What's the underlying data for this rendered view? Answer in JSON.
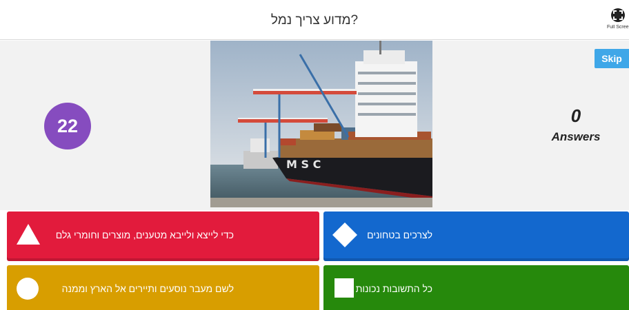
{
  "header": {
    "question": "?מדוע צריך נמל",
    "fullscreen_label": "Full Screen"
  },
  "game": {
    "timer": "22",
    "skip_label": "Skip",
    "answers_count": "0",
    "answers_label": "Answers"
  },
  "answers": [
    {
      "shape": "triangle",
      "text": "כדי לייצא ולייבא מטענים, מוצרים וחומרי גלם",
      "color": "#e21b3c"
    },
    {
      "shape": "diamond",
      "text": "לצרכים בטחונים",
      "color": "#1368ce"
    },
    {
      "shape": "circle",
      "text": "לשם מעבר נוסעים ותיירים אל הארץ וממנה",
      "color": "#d89e00"
    },
    {
      "shape": "square",
      "text": "כל התשובות נכונות",
      "color": "#26890c"
    }
  ],
  "colors": {
    "timer_bg": "#864cbf",
    "skip_bg": "#3fa7e8"
  }
}
